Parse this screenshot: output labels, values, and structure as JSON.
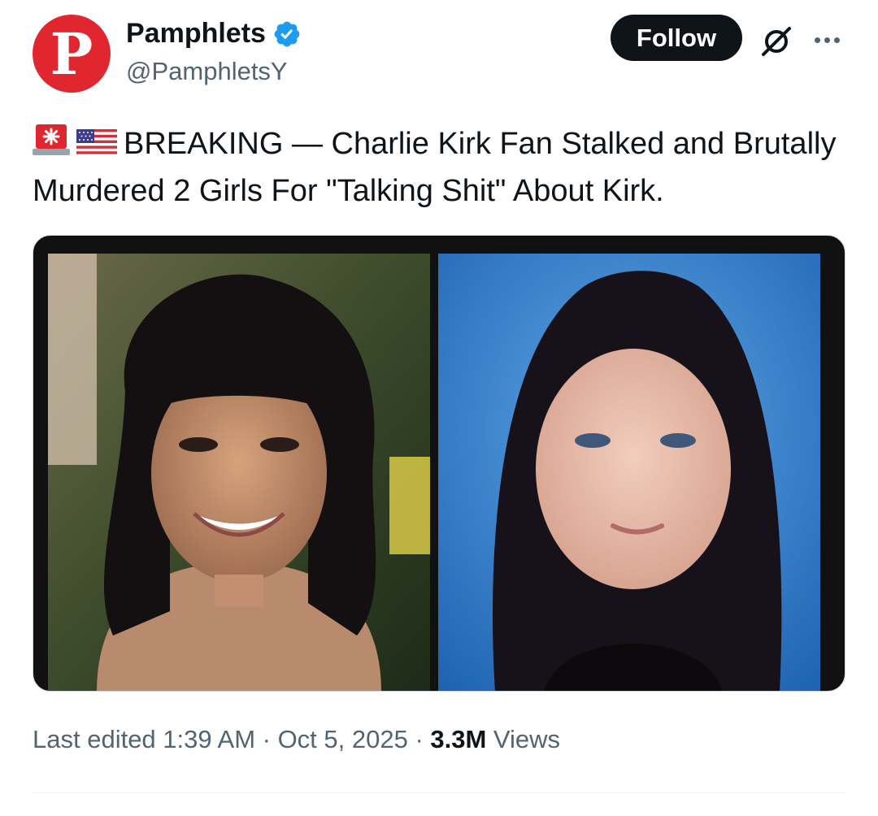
{
  "author": {
    "avatar_letter": "P",
    "display_name": "Pamphlets",
    "handle": "@PamphletsY",
    "verified_icon": "verified-badge-icon",
    "brand_color": "#e0262e"
  },
  "actions": {
    "follow_label": "Follow",
    "grok_icon": "grok-icon",
    "more_icon": "more-options-icon"
  },
  "post": {
    "emoji_1": "rotating-light-emoji",
    "emoji_2": "us-flag-emoji",
    "text": "BREAKING — Charlie Kirk Fan Stalked and Brutally Murdered 2 Girls For \"Talking Shit\" About Kirk."
  },
  "media": {
    "left_photo": "photo-girl-dark-bangs-smiling",
    "right_photo": "photo-girl-school-portrait-blue-background"
  },
  "meta": {
    "prefix": "Last edited 1:39 AM · Oct 5, 2025 · ",
    "views_count": "3.3M",
    "views_label": " Views"
  },
  "colors": {
    "text_primary": "#0f1419",
    "text_secondary": "#536471",
    "verified_blue": "#1d9bf0",
    "button_bg": "#0f1419"
  }
}
